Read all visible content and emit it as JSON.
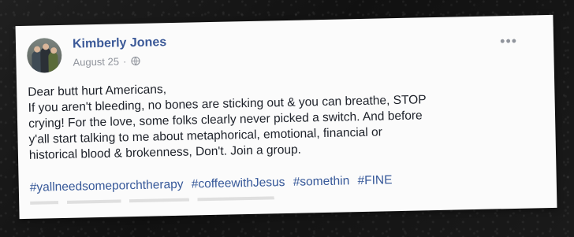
{
  "post": {
    "author": "Kimberly Jones",
    "date": "August 25",
    "date_separator": "·",
    "menu_icon": "more-horizontal-icon",
    "text_lines": [
      "Dear butt hurt Americans,",
      "If you aren't bleeding, no bones are sticking out & you can breathe, STOP",
      "crying! For the love, some folks clearly never picked a switch. And before",
      "y'all start talking to me about metaphorical, emotional, financial or",
      "historical blood & brokenness, Don't. Join a group."
    ],
    "hashtags": [
      "#yallneedsomeporchtherapy",
      "#coffeewithJesus",
      "#somethin",
      "#FINE"
    ]
  },
  "colors": {
    "author_link": "#3b5998",
    "hashtag_link": "#365899",
    "meta_text": "#90949c",
    "body_text": "#1d2129",
    "card_background": "#fbfbfb"
  },
  "icons": {
    "globe": "globe-icon",
    "more": "more-icon"
  }
}
